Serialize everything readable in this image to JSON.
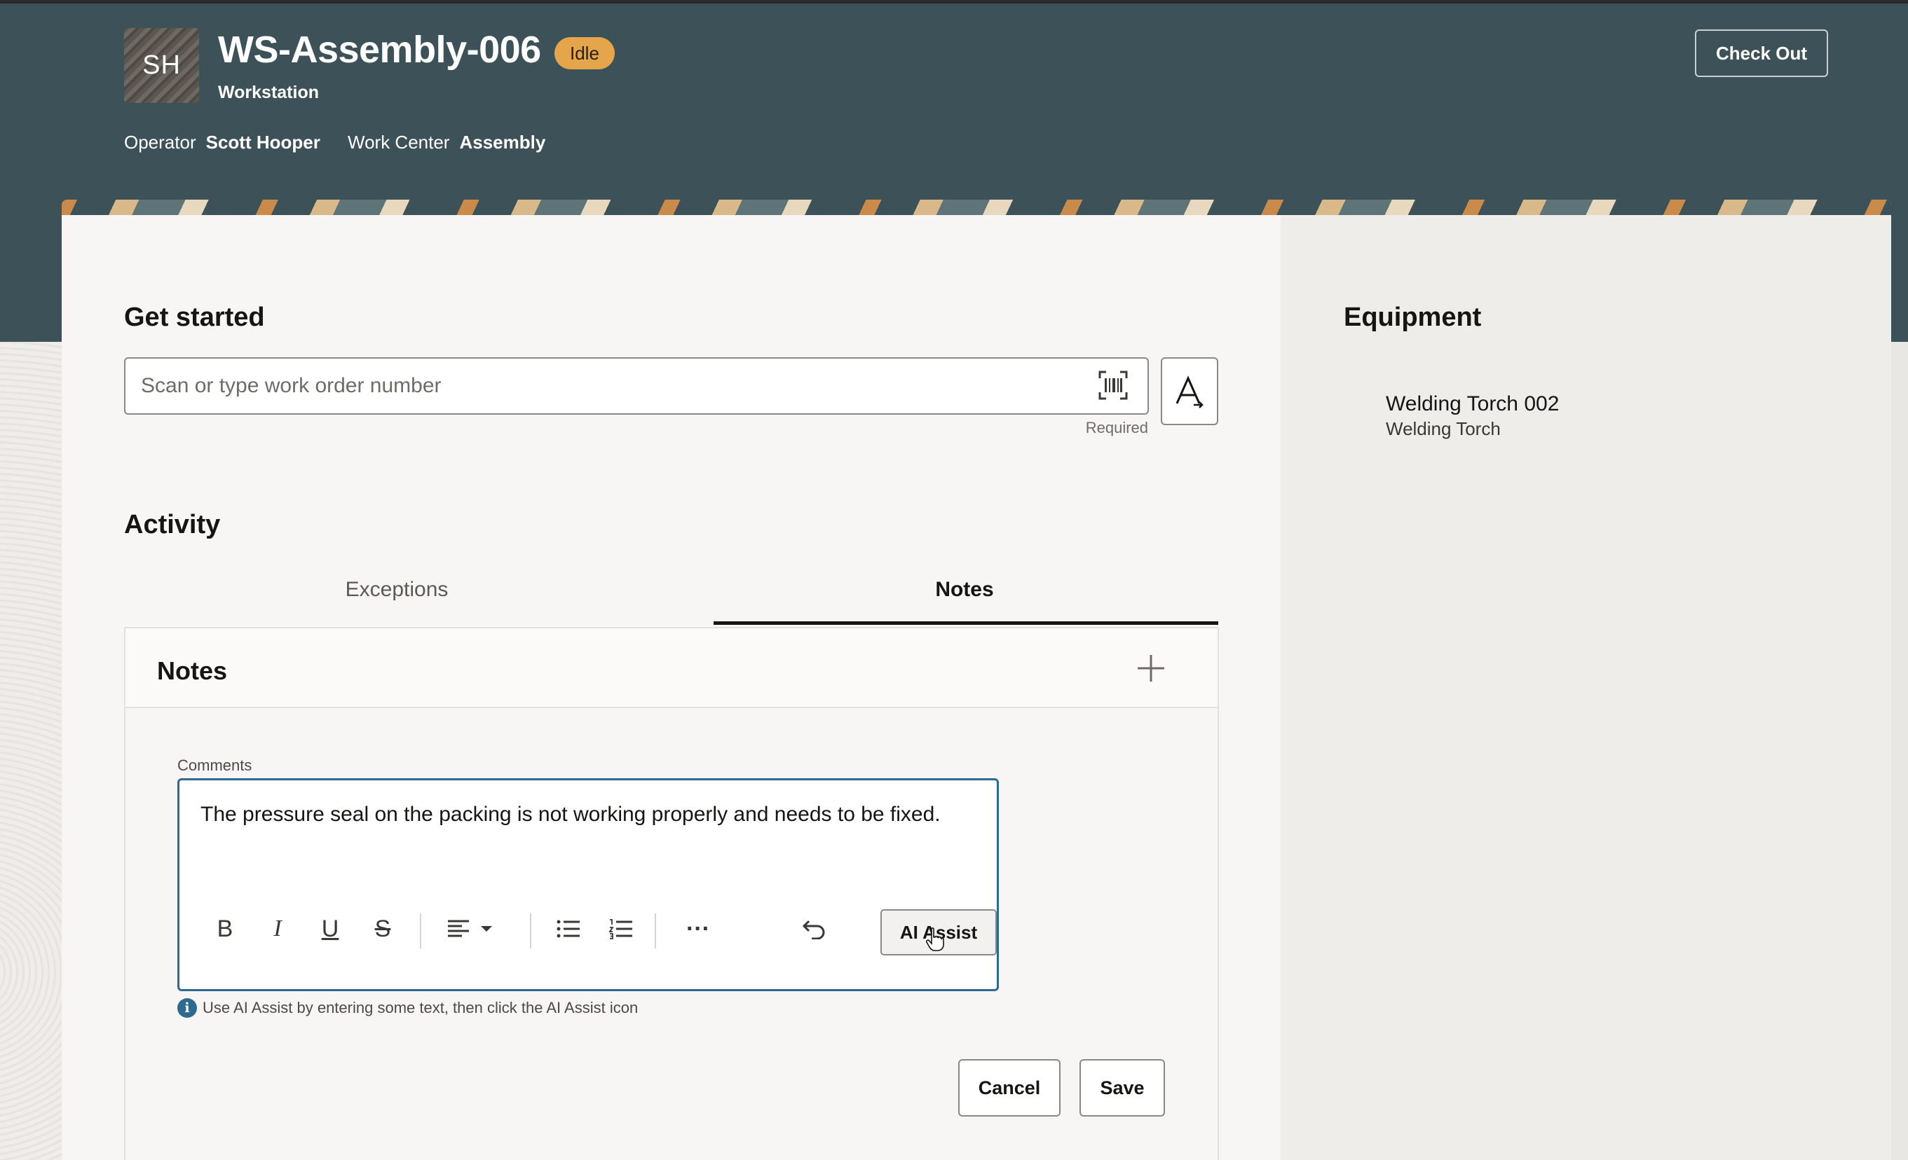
{
  "header": {
    "avatar_initials": "SH",
    "title": "WS-Assembly-006",
    "status": "Idle",
    "subtitle": "Workstation",
    "operator_label": "Operator",
    "operator_value": "Scott Hooper",
    "work_center_label": "Work Center",
    "work_center_value": "Assembly",
    "checkout_label": "Check Out"
  },
  "get_started": {
    "heading": "Get started",
    "input_placeholder": "Scan or type work order number",
    "required_label": "Required",
    "barcode_icon": "barcode-scan-icon",
    "text_icon": "text-entry-icon"
  },
  "activity": {
    "heading": "Activity",
    "tabs": [
      {
        "label": "Exceptions",
        "active": false
      },
      {
        "label": "Notes",
        "active": true
      }
    ]
  },
  "notes": {
    "title": "Notes",
    "add_icon": "plus-icon",
    "comments_label": "Comments",
    "comment_text": "The pressure seal on the packing is not working properly and needs to be fixed.",
    "toolbar": {
      "bold": "B",
      "italic": "I",
      "underline": "U",
      "strikethrough": "S",
      "more": "···",
      "ai_assist_label": "AI Assist"
    },
    "hint": "Use AI Assist by entering some text, then click the AI Assist icon",
    "cancel_label": "Cancel",
    "save_label": "Save"
  },
  "equipment": {
    "heading": "Equipment",
    "items": [
      {
        "name": "Welding Torch 002",
        "type": "Welding Torch"
      }
    ]
  },
  "colors": {
    "header_bg": "#3c5258",
    "status_badge": "#e5a54b",
    "focus_border": "#2d6a8f",
    "info": "#2d6a8f"
  }
}
